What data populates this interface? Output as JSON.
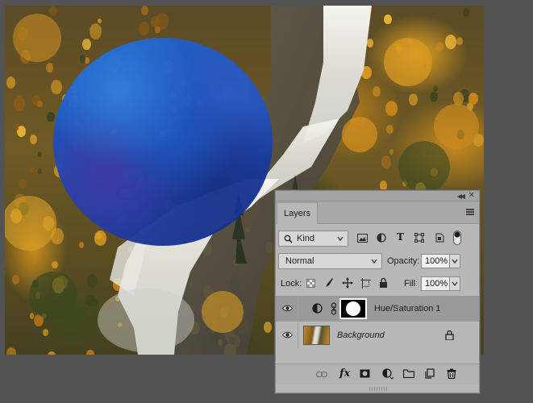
{
  "panel": {
    "tab_label": "Layers",
    "filter_kind": "Kind",
    "blend_mode": "Normal",
    "opacity_label": "Opacity:",
    "opacity_value": "100%",
    "lock_label": "Lock:",
    "fill_label": "Fill:",
    "fill_value": "100%",
    "layers": [
      {
        "name": "Hue/Saturation 1",
        "type": "adjustment",
        "visible": true,
        "selected": true
      },
      {
        "name": "Background",
        "type": "image",
        "visible": true,
        "selected": false,
        "locked": true
      }
    ]
  },
  "icons": {
    "panel_top": [
      "collapse-icon",
      "close-icon"
    ],
    "tab_row": [
      "panel-menu-icon"
    ],
    "filter_row": [
      "search-icon",
      "filter-pixel-icon",
      "filter-adjustment-icon",
      "filter-type-icon",
      "filter-shape-icon",
      "filter-smartobject-icon",
      "filter-toggle-icon"
    ],
    "lock_row": [
      "lock-transparent-icon",
      "lock-image-icon",
      "lock-position-icon",
      "lock-artboard-icon",
      "lock-all-icon"
    ],
    "bottom_bar": [
      "link-layers-icon",
      "fx-icon",
      "add-mask-icon",
      "new-adjustment-icon",
      "new-group-icon",
      "new-layer-icon",
      "delete-icon"
    ]
  },
  "colors": {
    "panel_bg": "#b8b8b8",
    "selected_layer": "#9a9a9a",
    "app_bg": "#535353",
    "circle_blue": "#1d5fd0"
  }
}
